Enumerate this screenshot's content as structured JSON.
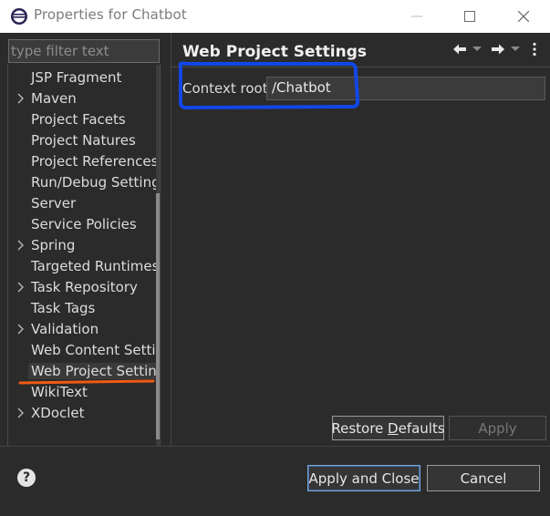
{
  "window": {
    "title": "Properties for Chatbot",
    "icon": "eclipse-icon",
    "controls": [
      "minimize-icon",
      "maximize-icon",
      "close-icon"
    ]
  },
  "filter": {
    "placeholder": "type filter text",
    "value": ""
  },
  "tree": {
    "items": [
      {
        "label": "JSP Fragment",
        "expandable": false
      },
      {
        "label": "Maven",
        "expandable": true
      },
      {
        "label": "Project Facets",
        "expandable": false
      },
      {
        "label": "Project Natures",
        "expandable": false
      },
      {
        "label": "Project References",
        "expandable": false
      },
      {
        "label": "Run/Debug Settings",
        "expandable": false
      },
      {
        "label": "Server",
        "expandable": false
      },
      {
        "label": "Service Policies",
        "expandable": false
      },
      {
        "label": "Spring",
        "expandable": true
      },
      {
        "label": "Targeted Runtimes",
        "expandable": false
      },
      {
        "label": "Task Repository",
        "expandable": true
      },
      {
        "label": "Task Tags",
        "expandable": false
      },
      {
        "label": "Validation",
        "expandable": true
      },
      {
        "label": "Web Content Settings",
        "expandable": false
      },
      {
        "label": "Web Project Settings",
        "expandable": false,
        "selected": true
      },
      {
        "label": "WikiText",
        "expandable": false
      },
      {
        "label": "XDoclet",
        "expandable": true
      }
    ]
  },
  "page": {
    "heading": "Web Project Settings",
    "context_root_label": "Context root:",
    "context_root_value": "/Chatbot",
    "nav_icons": [
      "back-arrow-icon",
      "back-dropdown-icon",
      "forward-arrow-icon",
      "forward-dropdown-icon",
      "view-menu-icon"
    ]
  },
  "buttons": {
    "restore_defaults": {
      "prefix": "Restore ",
      "mnemonic": "D",
      "suffix": "efaults"
    },
    "apply": "Apply",
    "apply_and_close": "Apply and Close",
    "cancel": "Cancel"
  },
  "colors": {
    "annotation_blue": "#1247e6",
    "annotation_orange": "#f05a14",
    "background": "#2b2b2b"
  }
}
